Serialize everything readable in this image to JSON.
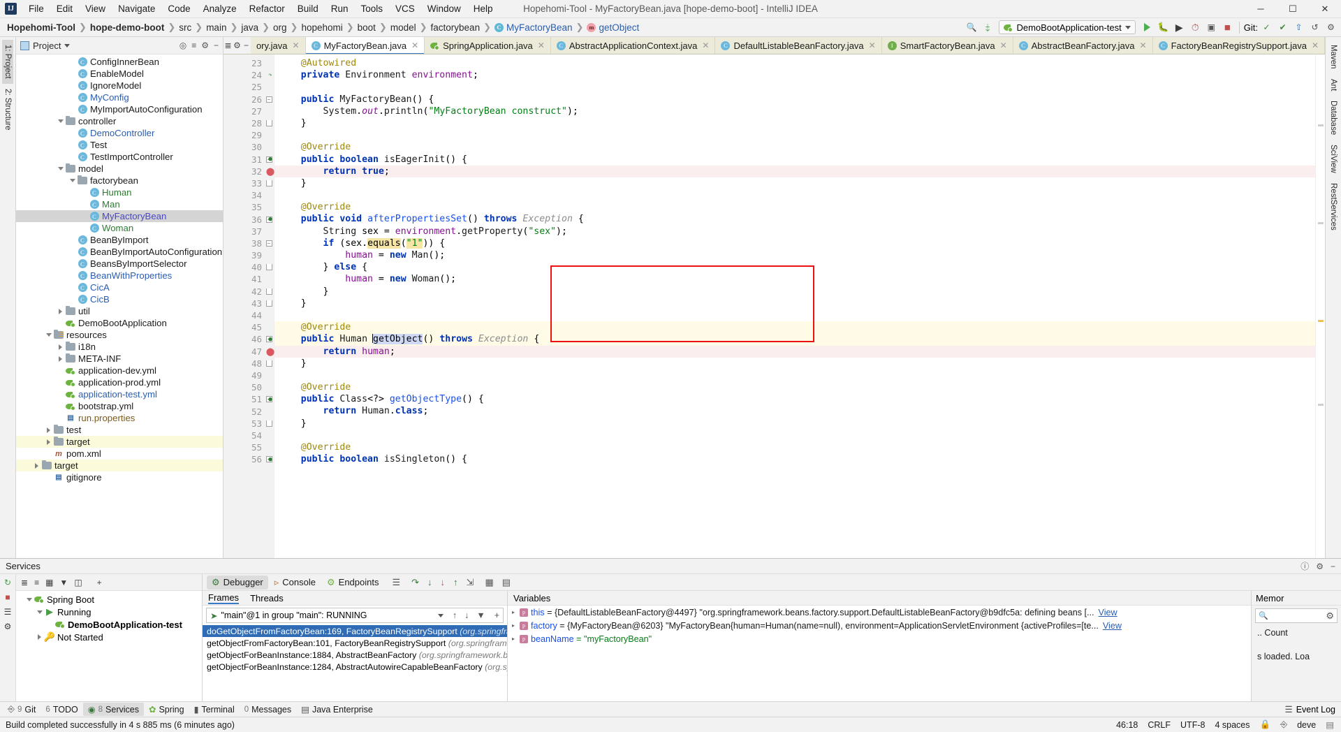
{
  "window": {
    "title": "Hopehomi-Tool - MyFactoryBean.java [hope-demo-boot] - IntelliJ IDEA",
    "logo": "IJ",
    "minimize": "─",
    "maximize": "☐",
    "close": "✕"
  },
  "menu": [
    "File",
    "Edit",
    "View",
    "Navigate",
    "Code",
    "Analyze",
    "Refactor",
    "Build",
    "Run",
    "Tools",
    "VCS",
    "Window",
    "Help"
  ],
  "breadcrumb": [
    {
      "label": "Hopehomi-Tool",
      "bold": true,
      "icon": null
    },
    {
      "label": "hope-demo-boot",
      "bold": true,
      "icon": null
    },
    {
      "label": "src",
      "bold": false,
      "icon": null
    },
    {
      "label": "main",
      "bold": false,
      "icon": null
    },
    {
      "label": "java",
      "bold": false,
      "icon": null
    },
    {
      "label": "org",
      "bold": false,
      "icon": null
    },
    {
      "label": "hopehomi",
      "bold": false,
      "icon": null
    },
    {
      "label": "boot",
      "bold": false,
      "icon": null
    },
    {
      "label": "model",
      "bold": false,
      "icon": null
    },
    {
      "label": "factorybean",
      "bold": false,
      "icon": null
    },
    {
      "label": "MyFactoryBean",
      "bold": false,
      "icon": "c",
      "blue": true
    },
    {
      "label": "getObject",
      "bold": false,
      "icon": "m",
      "blue": true
    }
  ],
  "toolbar": {
    "run_config": "DemoBootApplication-test",
    "run_label": "run-button",
    "debug_label": "debug-button",
    "git_label": "Git:",
    "icons": [
      "search",
      "run",
      "debug",
      "run-with-coverage",
      "profiler",
      "stop",
      "git-update",
      "git-commit",
      "git-push",
      "git-history"
    ]
  },
  "editor_tabs": [
    {
      "label": "ory.java",
      "icon": "c",
      "active": false,
      "partial": true
    },
    {
      "label": "MyFactoryBean.java",
      "icon": "c",
      "active": true
    },
    {
      "label": "SpringApplication.java",
      "icon": "spring",
      "active": false
    },
    {
      "label": "AbstractApplicationContext.java",
      "icon": "c",
      "active": false
    },
    {
      "label": "DefaultListableBeanFactory.java",
      "icon": "c",
      "active": false
    },
    {
      "label": "SmartFactoryBean.java",
      "icon": "i",
      "active": false
    },
    {
      "label": "AbstractBeanFactory.java",
      "icon": "c",
      "active": false
    },
    {
      "label": "FactoryBeanRegistrySupport.java",
      "icon": "c",
      "active": false
    }
  ],
  "project_panel": {
    "title": "Project",
    "tree": [
      {
        "indent": 4,
        "icon": "class",
        "label": "ConfigInnerBean",
        "color": "dark"
      },
      {
        "indent": 4,
        "icon": "class",
        "label": "EnableModel",
        "color": "dark"
      },
      {
        "indent": 4,
        "icon": "class",
        "label": "IgnoreModel",
        "color": "dark"
      },
      {
        "indent": 4,
        "icon": "class",
        "label": "MyConfig",
        "color": "blue"
      },
      {
        "indent": 4,
        "icon": "class",
        "label": "MyImportAutoConfiguration",
        "color": "dark"
      },
      {
        "indent": 3,
        "icon": "folder",
        "label": "controller",
        "color": "dark",
        "arrow": "down"
      },
      {
        "indent": 4,
        "icon": "class",
        "label": "DemoController",
        "color": "blue"
      },
      {
        "indent": 4,
        "icon": "class",
        "label": "Test",
        "color": "dark"
      },
      {
        "indent": 4,
        "icon": "class",
        "label": "TestImportController",
        "color": "dark"
      },
      {
        "indent": 3,
        "icon": "folder",
        "label": "model",
        "color": "dark",
        "arrow": "down"
      },
      {
        "indent": 4,
        "icon": "folder",
        "label": "factorybean",
        "color": "dark",
        "arrow": "down"
      },
      {
        "indent": 5,
        "icon": "class",
        "label": "Human",
        "color": "green"
      },
      {
        "indent": 5,
        "icon": "class",
        "label": "Man",
        "color": "green"
      },
      {
        "indent": 5,
        "icon": "class",
        "label": "MyFactoryBean",
        "color": "purple",
        "selected": true
      },
      {
        "indent": 5,
        "icon": "class",
        "label": "Woman",
        "color": "green"
      },
      {
        "indent": 4,
        "icon": "class",
        "label": "BeanByImport",
        "color": "dark"
      },
      {
        "indent": 4,
        "icon": "class",
        "label": "BeanByImportAutoConfiguration",
        "color": "dark"
      },
      {
        "indent": 4,
        "icon": "class",
        "label": "BeansByImportSelector",
        "color": "dark"
      },
      {
        "indent": 4,
        "icon": "class",
        "label": "BeanWithProperties",
        "color": "blue"
      },
      {
        "indent": 4,
        "icon": "class",
        "label": "CicA",
        "color": "blue"
      },
      {
        "indent": 4,
        "icon": "class",
        "label": "CicB",
        "color": "blue"
      },
      {
        "indent": 3,
        "icon": "folder",
        "label": "util",
        "color": "dark",
        "arrow": "right"
      },
      {
        "indent": 3,
        "icon": "spring",
        "label": "DemoBootApplication",
        "color": "dark"
      },
      {
        "indent": 2,
        "icon": "srcfolder",
        "label": "resources",
        "color": "dark",
        "arrow": "down"
      },
      {
        "indent": 3,
        "icon": "folder",
        "label": "i18n",
        "color": "dark",
        "arrow": "right"
      },
      {
        "indent": 3,
        "icon": "folder",
        "label": "META-INF",
        "color": "dark",
        "arrow": "right"
      },
      {
        "indent": 3,
        "icon": "yml",
        "label": "application-dev.yml",
        "color": "dark"
      },
      {
        "indent": 3,
        "icon": "yml",
        "label": "application-prod.yml",
        "color": "dark"
      },
      {
        "indent": 3,
        "icon": "yml",
        "label": "application-test.yml",
        "color": "blue"
      },
      {
        "indent": 3,
        "icon": "yml",
        "label": "bootstrap.yml",
        "color": "dark"
      },
      {
        "indent": 3,
        "icon": "props",
        "label": "run.properties",
        "color": "brown"
      },
      {
        "indent": 2,
        "icon": "folder",
        "label": "test",
        "color": "dark",
        "arrow": "right"
      },
      {
        "indent": 2,
        "icon": "folder",
        "label": "target",
        "color": "dark",
        "arrow": "right",
        "highlight": true
      },
      {
        "indent": 2,
        "icon": "maven",
        "label": "pom.xml",
        "color": "dark"
      },
      {
        "indent": 1,
        "icon": "folder",
        "label": "target",
        "color": "dark",
        "arrow": "right",
        "highlight": true
      },
      {
        "indent": 2,
        "icon": "file",
        "label": "gitignore",
        "color": "dark"
      }
    ]
  },
  "left_rail": [
    "1: Project",
    "2: Structure"
  ],
  "right_rail": [
    "Maven",
    "Ant",
    "Database",
    "SciView",
    "RestServices"
  ],
  "editor": {
    "first_line": 23,
    "lines": [
      {
        "n": 23,
        "html": "    <span class=\"an\">@Autowired</span>"
      },
      {
        "n": 24,
        "html": "    <span class=\"k\">private</span> <span class=\"ty\">Environment</span> <span class=\"fld\">environment</span>;",
        "gmark": "override"
      },
      {
        "n": 25,
        "html": ""
      },
      {
        "n": 26,
        "html": "    <span class=\"k\">public</span> <span class=\"ty\">MyFactoryBean</span>() {",
        "fold": true
      },
      {
        "n": 27,
        "html": "        <span class=\"ty\">System</span>.<span class=\"stat\">out</span>.<span class=\"pa\">println</span>(<span class=\"st\">\"MyFactoryBean construct\"</span>);"
      },
      {
        "n": 28,
        "html": "    }",
        "foldend": true
      },
      {
        "n": 29,
        "html": ""
      },
      {
        "n": 30,
        "html": "    <span class=\"an\">@Override</span>"
      },
      {
        "n": 31,
        "html": "    <span class=\"k\">public</span> <span class=\"k\">boolean</span> <span class=\"pa\">isEagerInit</span>() {",
        "fold": true,
        "gmark": "breakpoint-impl"
      },
      {
        "n": 32,
        "html": "        <span class=\"k\">return</span> <span class=\"k\">true</span>;",
        "hl": "pink",
        "gmark": "breakpoint"
      },
      {
        "n": 33,
        "html": "    }",
        "foldend": true
      },
      {
        "n": 34,
        "html": ""
      },
      {
        "n": 35,
        "html": "    <span class=\"an\">@Override</span>"
      },
      {
        "n": 36,
        "html": "    <span class=\"k\">public</span> <span class=\"k\">void</span> <span class=\"mth\">afterPropertiesSet</span>() <span class=\"k\">throws</span> <span class=\"cm\">Exception</span> {",
        "fold": true,
        "gmark": "breakpoint-impl"
      },
      {
        "n": 37,
        "html": "        <span class=\"ty\">String</span> sex = <span class=\"fld\">environment</span>.<span class=\"pa\">getProperty</span>(<span class=\"st\">\"sex\"</span>);"
      },
      {
        "n": 38,
        "html": "        <span class=\"k\">if</span> (sex.<span class=\"hl-search\">equals</span>(<span class=\"st hl-search\">\"1\"</span>)) {",
        "fold": true
      },
      {
        "n": 39,
        "html": "            <span class=\"fld\">human</span> = <span class=\"k\">new</span> <span class=\"ty\">Man</span>();"
      },
      {
        "n": 40,
        "html": "        } <span class=\"k\">else</span> {",
        "foldend": true
      },
      {
        "n": 41,
        "html": "            <span class=\"fld\">human</span> = <span class=\"k\">new</span> <span class=\"ty\">Woman</span>();"
      },
      {
        "n": 42,
        "html": "        }",
        "foldend": true
      },
      {
        "n": 43,
        "html": "    }",
        "foldend": true
      },
      {
        "n": 44,
        "html": ""
      },
      {
        "n": 45,
        "html": "    <span class=\"an\">@Override</span>",
        "hl": "yellow"
      },
      {
        "n": 46,
        "html": "    <span class=\"k\">public</span> <span class=\"ty\">Human</span> <span class=\"cursor\"></span><span class=\"sel-word\">getObject</span>() <span class=\"k\">throws</span> <span class=\"cm\">Exception</span> {",
        "hl": "yellow",
        "fold": true,
        "gmark": "breakpoint-impl",
        "bulb": true
      },
      {
        "n": 47,
        "html": "        <span class=\"k\">return</span> <span class=\"fld\">human</span>;",
        "hl": "pink",
        "gmark": "breakpoint"
      },
      {
        "n": 48,
        "html": "    }",
        "foldend": true
      },
      {
        "n": 49,
        "html": ""
      },
      {
        "n": 50,
        "html": "    <span class=\"an\">@Override</span>"
      },
      {
        "n": 51,
        "html": "    <span class=\"k\">public</span> <span class=\"ty\">Class</span>&lt;?&gt; <span class=\"mth\">getObjectType</span>() {",
        "fold": true,
        "gmark": "breakpoint-impl"
      },
      {
        "n": 52,
        "html": "        <span class=\"k\">return</span> <span class=\"ty\">Human</span>.<span class=\"k\">class</span>;"
      },
      {
        "n": 53,
        "html": "    }",
        "foldend": true
      },
      {
        "n": 54,
        "html": ""
      },
      {
        "n": 55,
        "html": "    <span class=\"an\">@Override</span>"
      },
      {
        "n": 56,
        "html": "    <span class=\"k\">public</span> <span class=\"k\">boolean</span> <span class=\"pa\">isSingleton</span>() {",
        "fold": true,
        "gmark": "breakpoint-impl"
      }
    ]
  },
  "services_panel": {
    "title": "Services",
    "tree": [
      {
        "indent": 0,
        "label": "Spring Boot",
        "arrow": "down",
        "icon": "spring"
      },
      {
        "indent": 1,
        "label": "Running",
        "arrow": "down",
        "icon": "run"
      },
      {
        "indent": 2,
        "label": "DemoBootApplication-test",
        "bold": true,
        "icon": "spring"
      },
      {
        "indent": 1,
        "label": "Not Started",
        "arrow": "right",
        "icon": "key"
      }
    ],
    "tabs": [
      {
        "label": "Debugger",
        "active": true,
        "icon": "debugger"
      },
      {
        "label": "Console",
        "active": false,
        "icon": "console"
      },
      {
        "label": "Endpoints",
        "active": false,
        "icon": "endpoints"
      }
    ],
    "frames": {
      "tab_frames": "Frames",
      "tab_threads": "Threads",
      "thread_selector": "\"main\"@1 in group \"main\": RUNNING",
      "rows": [
        {
          "method": "doGetObjectFromFactoryBean:169, FactoryBeanRegistrySupport",
          "pkg": "(org.springframework.b",
          "selected": true
        },
        {
          "method": "getObjectFromFactoryBean:101, FactoryBeanRegistrySupport",
          "pkg": "(org.springframework.bean",
          "selected": false
        },
        {
          "method": "getObjectForBeanInstance:1884, AbstractBeanFactory",
          "pkg": "(org.springframework.beans.factor",
          "selected": false
        },
        {
          "method": "getObjectForBeanInstance:1284, AbstractAutowireCapableBeanFactory",
          "pkg": "(org.springframew",
          "selected": false
        }
      ]
    },
    "variables": {
      "title": "Variables",
      "rows": [
        {
          "name": "this",
          "value": "= {DefaultListableBeanFactory@4497} \"org.springframework.beans.factory.support.DefaultListableBeanFactory@b9dfc5a: defining beans [...",
          "link": "View"
        },
        {
          "name": "factory",
          "value": "= {MyFactoryBean@6203} \"MyFactoryBean{human=Human(name=null), environment=ApplicationServletEnvironment {activeProfiles=[te...",
          "link": "View"
        },
        {
          "name": "beanName",
          "value": "= \"myFactoryBean\"",
          "link": null,
          "string": true
        }
      ]
    },
    "memory": {
      "title": "Memor",
      "search_placeholder": "",
      "count_label": ".. Count",
      "loaded_text": "s loaded. Loa"
    }
  },
  "tool_windows": {
    "left": [
      {
        "num": "9",
        "label": "Git",
        "active": false
      },
      {
        "num": "6",
        "label": "TODO",
        "active": false
      },
      {
        "num": "8",
        "label": "Services",
        "active": true
      },
      {
        "num": "",
        "label": "Spring",
        "active": false
      },
      {
        "num": "",
        "label": "Terminal",
        "active": false
      },
      {
        "num": "0",
        "label": "Messages",
        "active": false
      },
      {
        "num": "",
        "label": "Java Enterprise",
        "active": false
      }
    ],
    "right": [
      {
        "label": "Event Log"
      }
    ]
  },
  "status_bar": {
    "message": "Build completed successfully in 4 s 885 ms (6 minutes ago)",
    "caret": "46:18",
    "line_sep": "CRLF",
    "encoding": "UTF-8",
    "indent": "4 spaces",
    "branch": "deve",
    "lock": "lock-icon"
  },
  "colors": {
    "accent_blue": "#3c78c8",
    "selection_blue": "#2f6cb5",
    "red_box": "#ee1111",
    "breakpoint_red": "#db5860",
    "spring_green": "#6db33f",
    "tab_bg": "#ecebd9",
    "highlight_yellow": "#fffbe6",
    "highlight_pink": "#fbeeee"
  }
}
